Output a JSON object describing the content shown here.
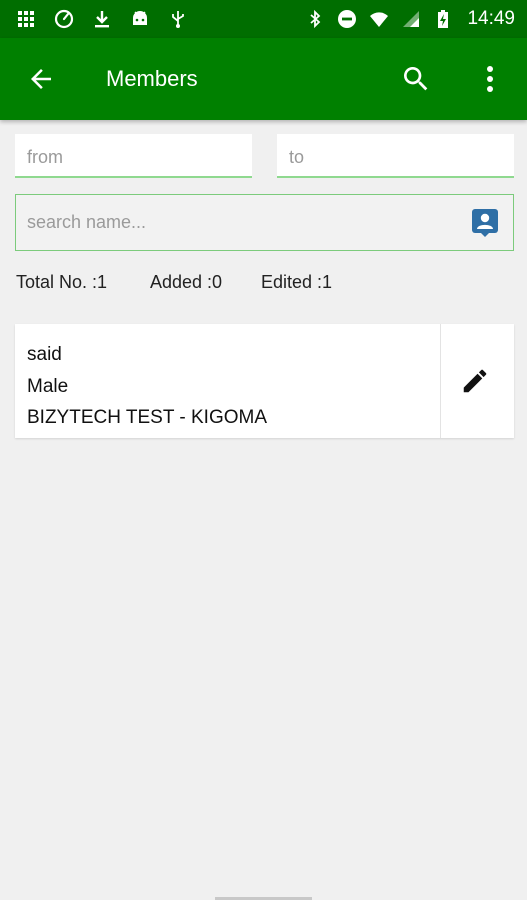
{
  "status_bar": {
    "time": "14:49",
    "left_icons": [
      "grid-icon",
      "speed-icon",
      "download-icon",
      "android-icon",
      "usb-icon"
    ],
    "right_icons": [
      "bluetooth-icon",
      "do-not-disturb-icon",
      "wifi-icon",
      "signal-icon",
      "battery-charging-icon"
    ]
  },
  "app_bar": {
    "title": "Members",
    "back_icon": "arrow-back-icon",
    "search_icon": "search-icon",
    "menu_icon": "more-vert-icon"
  },
  "filters": {
    "from_placeholder": "from",
    "to_placeholder": "to"
  },
  "search": {
    "placeholder": "search name...",
    "value": "",
    "icon": "contact-card-icon"
  },
  "stats": {
    "total": "Total No. :1",
    "added": "Added :0",
    "edited": "Edited :1"
  },
  "members": [
    {
      "name": "said",
      "gender": "Male",
      "group": "BIZYTECH TEST - KIGOMA",
      "action_icon": "edit-icon"
    }
  ],
  "colors": {
    "status_bar": "#006e00",
    "app_bar": "#008000",
    "field_underline": "#8fd98f",
    "search_border": "#7ccb7c",
    "contact_icon": "#2f6fa6",
    "background": "#f0f0f0"
  }
}
